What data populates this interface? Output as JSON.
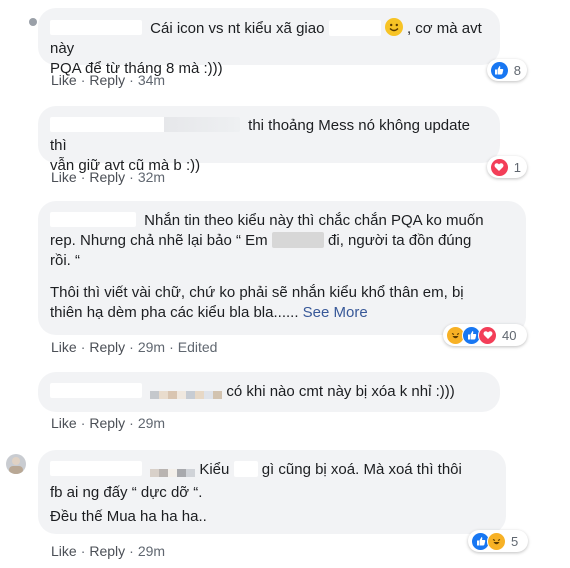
{
  "comments": [
    {
      "line1": "Cái icon vs nt kiểu xã giao",
      "line1_after": ", cơ mà avt này",
      "line2": "PQA để từ tháng 8 mà :)))",
      "like": "Like",
      "reply": "Reply",
      "time": "34m",
      "edited": "",
      "reaction_count": "8"
    },
    {
      "line1": "thi thoảng Mess nó không update thì",
      "line2": "vẫn giữ avt cũ mà b :))",
      "like": "Like",
      "reply": "Reply",
      "time": "32m",
      "edited": "",
      "reaction_count": "1"
    },
    {
      "line1": "Nhắn tin theo kiểu này thì chắc chắn PQA ko muốn",
      "line2_a": "rep. Nhưng chả nhẽ lại bảo “ Em",
      "line2_b": "đi, người ta đồn đúng",
      "line3": "rồi. “",
      "line4": "Thôi thì viết vài chữ, chứ ko phải sẽ nhắn kiểu khổ thân em, bị",
      "line5": "thiên hạ dèm pha các kiểu bla bla......",
      "see_more": "See More",
      "like": "Like",
      "reply": "Reply",
      "time": "29m",
      "edited": "Edited",
      "reaction_count": "40"
    },
    {
      "line1": "có khi nào cmt này bị xóa k nhỉ :)))",
      "like": "Like",
      "reply": "Reply",
      "time": "29m",
      "edited": ""
    },
    {
      "line1_a": "Kiểu",
      "line1_b": "gì cũng bị xoá. Mà xoá thì thôi",
      "line2": "fb ai ng đấy “ dực dỡ “.",
      "line3": "Đều thế Mua ha ha ha..",
      "like": "Like",
      "reply": "Reply",
      "time": "29m",
      "edited": "",
      "reaction_count": "5"
    }
  ],
  "separator": "·",
  "colors": {
    "bubble": "#f2f3f5",
    "link": "#385898",
    "like_blue": "#1877f2",
    "love_red": "#f33e58",
    "haha_yellow": "#f7b125"
  },
  "icons": [
    "like-reaction-icon",
    "love-reaction-icon",
    "haha-reaction-icon",
    "smile-emoji-icon"
  ]
}
